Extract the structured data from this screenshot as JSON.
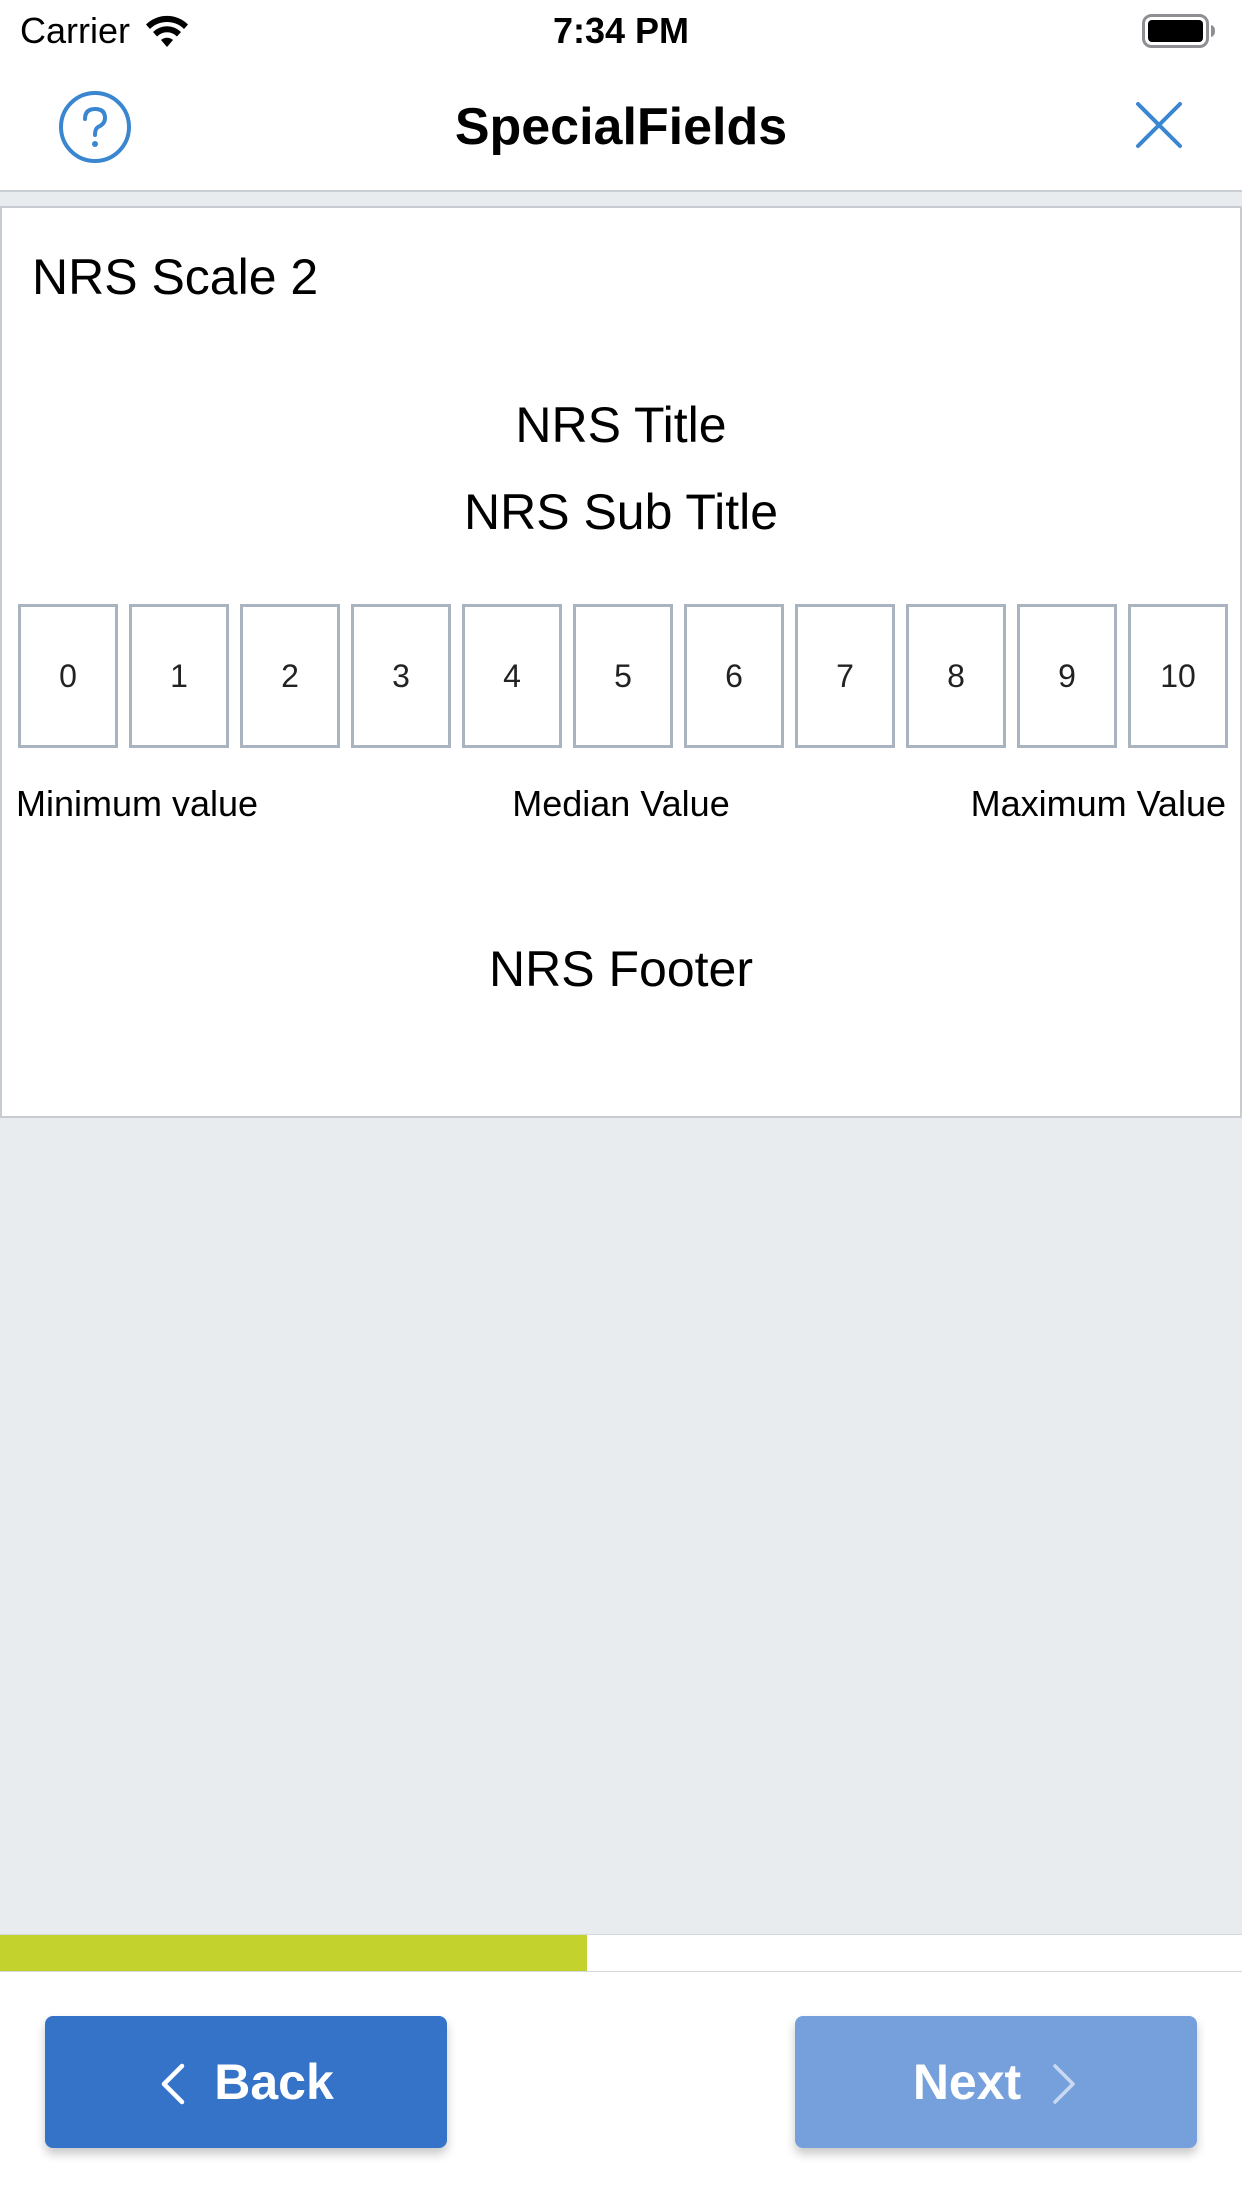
{
  "status_bar": {
    "carrier": "Carrier",
    "time": "7:34 PM",
    "wifi_icon": "wifi-icon",
    "battery_icon": "battery-full-icon"
  },
  "nav": {
    "title": "SpecialFields",
    "help_icon": "help-circle-icon",
    "close_icon": "close-icon",
    "accent_color": "#3a86d1"
  },
  "card": {
    "heading": "NRS Scale 2",
    "nrs_title": "NRS Title",
    "nrs_subtitle": "NRS Sub Title",
    "scale_values": [
      "0",
      "1",
      "2",
      "3",
      "4",
      "5",
      "6",
      "7",
      "8",
      "9",
      "10"
    ],
    "min_label": "Minimum value",
    "median_label": "Median Value",
    "max_label": "Maximum Value",
    "footer": "NRS Footer"
  },
  "progress": {
    "fraction": 0.473,
    "color": "#c4d22d"
  },
  "buttons": {
    "back_label": "Back",
    "next_label": "Next",
    "back_color": "#3473c8",
    "next_color": "#76a0dc"
  }
}
